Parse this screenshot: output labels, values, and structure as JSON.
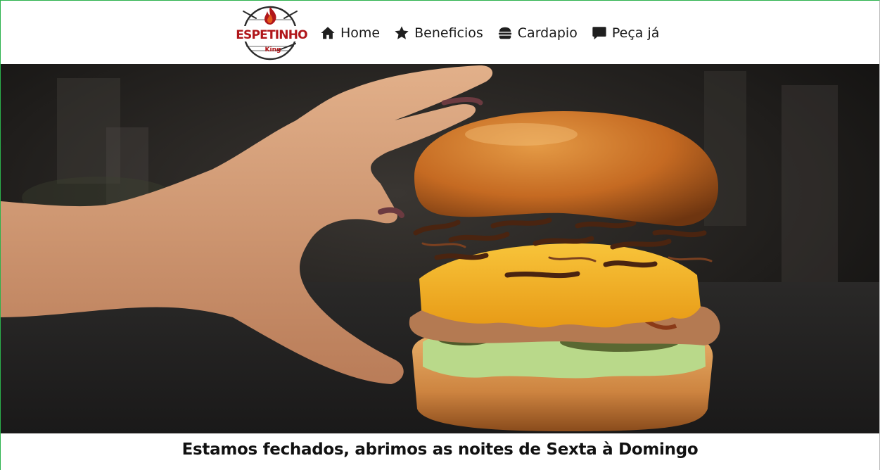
{
  "brand": {
    "logo_text": "ESPETINHO",
    "logo_subtext": "King",
    "colors": {
      "primary": "#b0161a",
      "dark": "#2a2a2a"
    }
  },
  "nav": {
    "items": [
      {
        "label": "Home",
        "icon": "home-icon"
      },
      {
        "label": "Beneficios",
        "icon": "star-icon"
      },
      {
        "label": "Cardapio",
        "icon": "burger-icon"
      },
      {
        "label": "Peça já",
        "icon": "chat-icon"
      }
    ]
  },
  "hero": {
    "image": "burger-with-hand-photo"
  },
  "status": {
    "message": "Estamos fechados, abrimos as noites de Sexta à Domingo"
  }
}
